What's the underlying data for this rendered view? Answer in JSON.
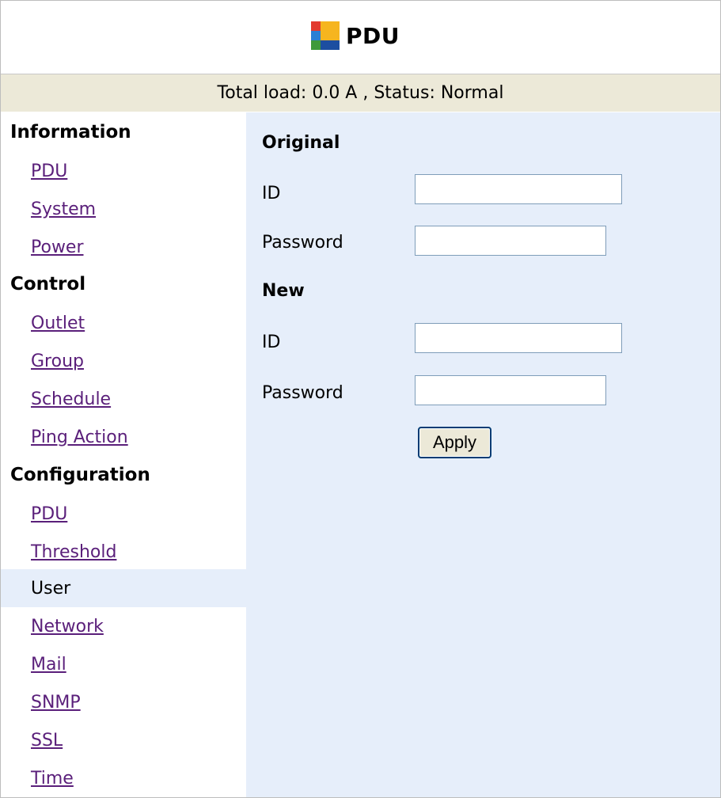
{
  "header": {
    "title": "PDU",
    "icon": "pdu-logo-icon"
  },
  "status_bar": {
    "text": "Total load: 0.0 A , Status: Normal"
  },
  "sidebar": {
    "sections": [
      {
        "heading": "Information",
        "items": [
          "PDU",
          "System",
          "Power"
        ]
      },
      {
        "heading": "Control",
        "items": [
          "Outlet",
          "Group",
          "Schedule",
          "Ping Action"
        ]
      },
      {
        "heading": "Configuration",
        "items": [
          "PDU",
          "Threshold",
          "User",
          "Network",
          "Mail",
          "SNMP",
          "SSL",
          "Time"
        ]
      }
    ],
    "active_item": "User",
    "link_color": "#5a1f7a",
    "active_bg": "#e6eefa"
  },
  "main": {
    "original": {
      "heading": "Original",
      "id_label": "ID",
      "id_value": "",
      "password_label": "Password",
      "password_value": ""
    },
    "new": {
      "heading": "New",
      "id_label": "ID",
      "id_value": "",
      "password_label": "Password",
      "password_value": ""
    },
    "apply_label": "Apply",
    "background": "#e6eefa"
  }
}
